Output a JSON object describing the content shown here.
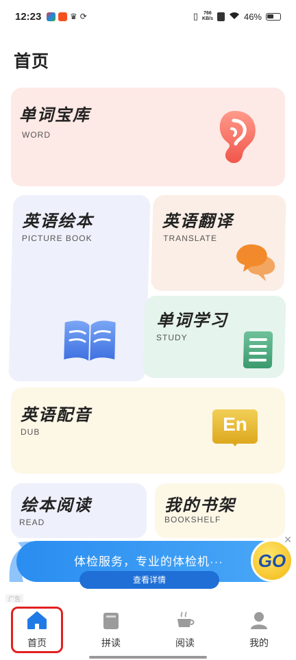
{
  "status_bar": {
    "time": "12:23",
    "net_speed_value": "766",
    "net_speed_unit": "KB/s",
    "battery": "46%"
  },
  "page": {
    "title": "首页"
  },
  "cards": {
    "word": {
      "title": "单词宝库",
      "subtitle": "WORD"
    },
    "picture_book": {
      "title": "英语绘本",
      "subtitle": "PICTURE BOOK"
    },
    "translate": {
      "title": "英语翻译",
      "subtitle": "TRANSLATE"
    },
    "study": {
      "title": "单词学习",
      "subtitle": "STUDY"
    },
    "dub": {
      "title": "英语配音",
      "subtitle": "DUB",
      "badge": "En"
    },
    "read": {
      "title": "绘本阅读",
      "subtitle": "READ"
    },
    "bookshelf": {
      "title": "我的书架",
      "subtitle": "BOOKSHELF"
    }
  },
  "ad": {
    "text": "体检服务，专业的体检机···",
    "button": "查看详情",
    "go": "GO",
    "tag": "广告",
    "close": "✕"
  },
  "nav": {
    "items": [
      {
        "label": "首页",
        "icon": "home-icon"
      },
      {
        "label": "拼读",
        "icon": "book-icon"
      },
      {
        "label": "阅读",
        "icon": "cup-icon"
      },
      {
        "label": "我的",
        "icon": "user-icon"
      }
    ]
  },
  "colors": {
    "nav_active": "#1f7ae6",
    "highlight": "#e02020",
    "ad_blue": "#2a8df0"
  }
}
